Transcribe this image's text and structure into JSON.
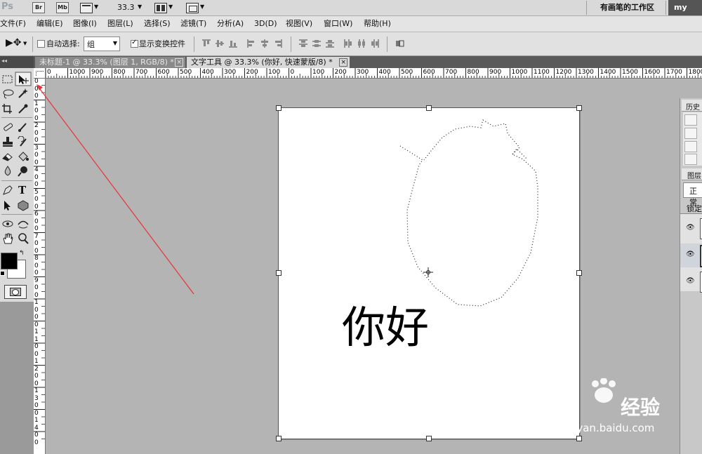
{
  "app": {
    "logo": "Ps",
    "bridge_label": "Br",
    "minibridge_label": "Mb",
    "zoom_value": "33.3",
    "workspace_name": "有画笔的工作区",
    "workspace_button": "my wor"
  },
  "menu": [
    "文件(F)",
    "编辑(E)",
    "图像(I)",
    "图层(L)",
    "选择(S)",
    "滤镜(T)",
    "分析(A)",
    "3D(D)",
    "视图(V)",
    "窗口(W)",
    "帮助(H)"
  ],
  "options": {
    "auto_select_label": "自动选择:",
    "auto_select_value": "组",
    "show_transform_label": "显示变换控件",
    "show_transform_checked": true
  },
  "tabs": [
    {
      "title": "未标题-1 @ 33.3% (图层 1, RGB/8) *",
      "active": false
    },
    {
      "title": "文字工具 @ 33.3% (你好, 快速蒙版/8) *",
      "active": true
    }
  ],
  "ruler": {
    "h_labels": [
      "0",
      "1000",
      "900",
      "800",
      "700",
      "600",
      "500",
      "400",
      "300",
      "200",
      "100",
      "0",
      "100",
      "200",
      "300",
      "400",
      "500",
      "600",
      "700",
      "800",
      "900",
      "1000",
      "1100",
      "1200",
      "1300",
      "1400",
      "1500",
      "1600",
      "1700",
      "1800"
    ],
    "v_labels": [
      "0",
      "0",
      "0",
      "1",
      "0",
      "0",
      "2",
      "0",
      "0",
      "3",
      "0",
      "0",
      "4",
      "0",
      "0",
      "5",
      "0",
      "0",
      "6",
      "0",
      "0",
      "7",
      "0",
      "0",
      "8",
      "0",
      "0",
      "9",
      "0",
      "0",
      "1",
      "0",
      "0",
      "0",
      "1",
      "1",
      "0",
      "0",
      "1",
      "2",
      "0",
      "0",
      "1",
      "3",
      "0",
      "0",
      "1",
      "4",
      "0",
      "0"
    ]
  },
  "document": {
    "text": "你好"
  },
  "panels": {
    "history_tab": "历史记",
    "layers_tab": "图层",
    "blend_mode": "正常",
    "lock_label": "锁定"
  },
  "watermark": {
    "brand": "Bai",
    "brand2": "经验",
    "url": "jingyan.baidu.com"
  },
  "colors": {
    "foreground": "#000000",
    "background": "#ffffff",
    "annotation_arrow": "#e8323a"
  }
}
